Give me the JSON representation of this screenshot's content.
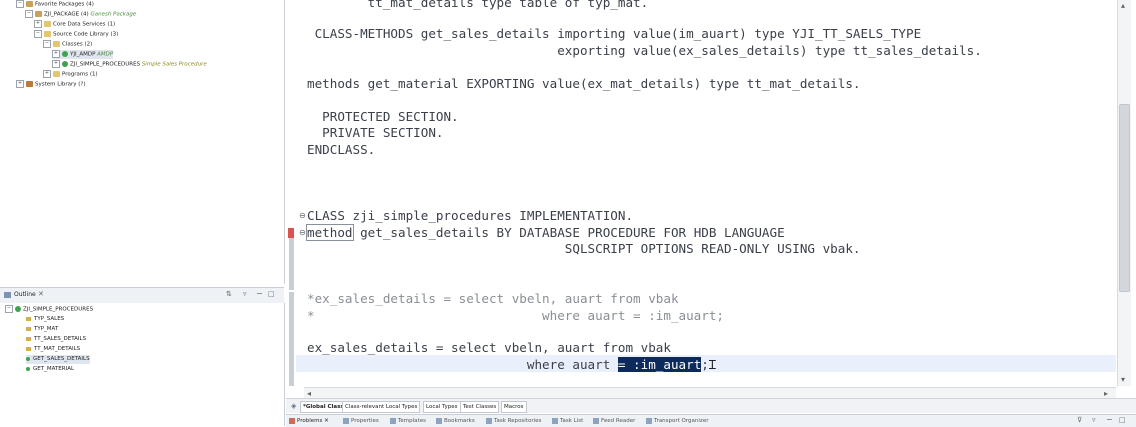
{
  "project_tree": [
    {
      "label": "Favorite Packages",
      "count": "(4)"
    },
    {
      "label": "ZJI_PACKAGE",
      "count": "(4)",
      "annotation": "Ganesh Package"
    },
    {
      "label": "Core Data Services",
      "count": "(1)"
    },
    {
      "label": "Source Code Library",
      "count": "(3)"
    },
    {
      "label": "Classes",
      "count": "(2)"
    },
    {
      "label": "YJI_AMDP",
      "annotation": "AMDP"
    },
    {
      "label": "ZJI_SIMPLE_PROCEDURES",
      "annotation": "Simple Sales Procedure"
    },
    {
      "label": "Programs",
      "count": "(1)"
    },
    {
      "label": "System Library",
      "count": "(?)"
    }
  ],
  "outline": {
    "title": "Outline",
    "root": "ZJI_SIMPLE_PROCEDURES",
    "items": [
      "TYP_SALES",
      "TYP_MAT",
      "TT_SALES_DETAILS",
      "TT_MAT_DETAILS",
      "GET_SALES_DETAILS",
      "GET_MATERIAL"
    ]
  },
  "code_lines": [
    "        tt_mat_details type table of typ_mat.",
    " CLASS-METHODS get_sales_details importing value(im_auart) type YJI_TT_SAELS_TYPE",
    "                                 exporting value(ex_sales_details) type tt_sales_details.",
    "methods get_material EXPORTING value(ex_mat_details) type tt_mat_details.",
    "  PROTECTED SECTION.",
    "  PRIVATE SECTION.",
    "ENDCLASS.",
    "CLASS zji_simple_procedures IMPLEMENTATION.",
    " get_sales_details BY DATABASE PROCEDURE FOR HDB LANGUAGE",
    "                                  SQLSCRIPT OPTIONS READ-ONLY USING vbak.",
    "*ex_sales_details = select vbeln, auart from vbak",
    "*                              where auart = :im_auart;",
    "ex_sales_details = select vbeln, auart from vbak",
    "                             where auart "
  ],
  "code_keyword_method": "method",
  "code_selection": "= :im_auart",
  "code_after_selection": ";",
  "editor_tabs": [
    "*Global Class",
    "Class-relevant Local Types",
    "Local Types",
    "Test Classes",
    "Macros"
  ],
  "bottom_tabs": [
    "Problems",
    "Properties",
    "Templates",
    "Bookmarks",
    "Task Repositories",
    "Task List",
    "Feed Reader",
    "Transport Organizer"
  ]
}
